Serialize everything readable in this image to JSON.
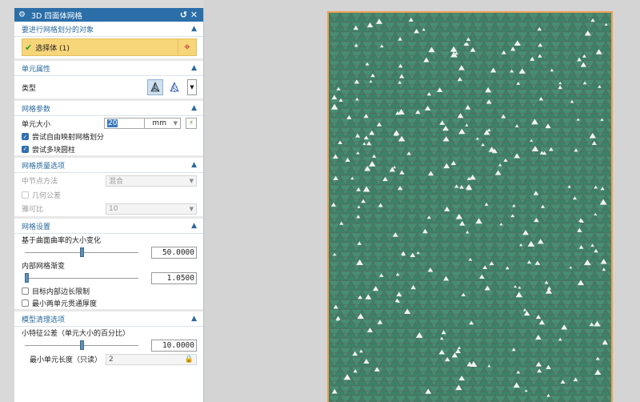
{
  "dialog": {
    "title": "3D 四面体网格",
    "sections": {
      "objects": {
        "header": "要进行网格划分的对象",
        "selection_label": "选择体 (1)"
      },
      "element": {
        "header": "单元属性",
        "type_label": "类型"
      },
      "mesh_params": {
        "header": "网格参数",
        "size_label": "单元大小",
        "size_value": "20",
        "unit": "mm",
        "cb_mapped": "尝试自由映射网格划分",
        "cb_mapped_checked": true,
        "cb_prism": "尝试多块圆柱",
        "cb_prism_checked": true
      },
      "quality": {
        "header": "网格质量选项",
        "midnode_label": "中节点方法",
        "midnode_value": "混合",
        "geom_tol_label": "几何公差",
        "aspect_label": "雅可比",
        "aspect_value": "10"
      },
      "settings": {
        "header": "网格设置",
        "curvature_label": "基于曲面曲率的大小变化",
        "curvature_value": "50.0000",
        "curvature_fraction": 0.5,
        "transition_label": "内部网格渐变",
        "transition_value": "1.0500",
        "transition_fraction": 0.0,
        "cb_edge": "目标内部边长限制",
        "cb_thickness": "最小两单元贯通厚度"
      },
      "cleanup": {
        "header": "模型清理选项",
        "small_feature_label": "小特征公差（单元大小的百分比）",
        "small_feature_value": "10.0000",
        "small_feature_fraction": 0.5,
        "min_elem_label": "最小单元长度（只读）",
        "min_elem_value": "2"
      }
    }
  },
  "colors": {
    "mesh_fill": "#3f8a6c",
    "mesh_edge": "#5e5e5e",
    "frame": "#f0a050",
    "title_bar": "#2b6ea8",
    "section_header": "#2a6a9e",
    "selection_bg": "#f7d67a"
  }
}
